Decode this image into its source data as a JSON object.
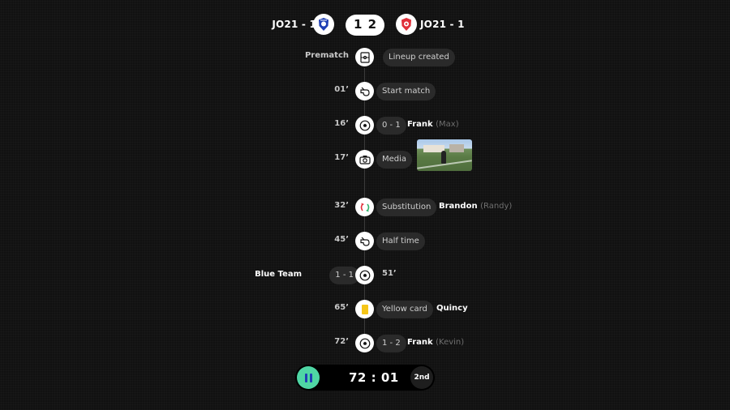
{
  "header": {
    "home_team": "JO21 - 1",
    "away_team": "JO21 - 1",
    "home_score": "1",
    "away_score": "2",
    "home_crest_icon": "shield-crest-blue",
    "away_crest_icon": "shield-crest-red"
  },
  "events": {
    "prematch": {
      "minute": "Prematch",
      "label": "Lineup created",
      "icon": "lineup-board-icon"
    },
    "start": {
      "minute": "01’",
      "label": "Start match",
      "icon": "whistle-icon"
    },
    "goal1": {
      "minute": "16’",
      "score": "0 - 1",
      "player": "Frank",
      "assist": "(Max)",
      "icon": "soccer-ball-icon"
    },
    "media": {
      "minute": "17’",
      "label": "Media",
      "icon": "camera-icon"
    },
    "sub": {
      "minute": "32’",
      "label": "Substitution",
      "player": "Brandon",
      "assist": "(Randy)",
      "icon": "substitution-icon"
    },
    "halftime": {
      "minute": "45’",
      "label": "Half time",
      "icon": "whistle-icon"
    },
    "goal2": {
      "minute": "51’",
      "team": "Blue Team",
      "score": "1 - 1",
      "icon": "soccer-ball-icon"
    },
    "card": {
      "minute": "65’",
      "label": "Yellow card",
      "player": "Quincy",
      "icon": "yellow-card-icon"
    },
    "goal3": {
      "minute": "72’",
      "score": "1 - 2",
      "player": "Frank",
      "assist": "(Kevin)",
      "icon": "soccer-ball-icon"
    }
  },
  "clock": {
    "time": "72 : 01",
    "period": "2nd",
    "pause_color": "#4fd6a4"
  },
  "colors": {
    "background": "#111111",
    "pill": "#2a2a2a",
    "home_crest": "#1f3fb4",
    "away_crest": "#e0303a",
    "yellow_card": "#f5c518"
  }
}
